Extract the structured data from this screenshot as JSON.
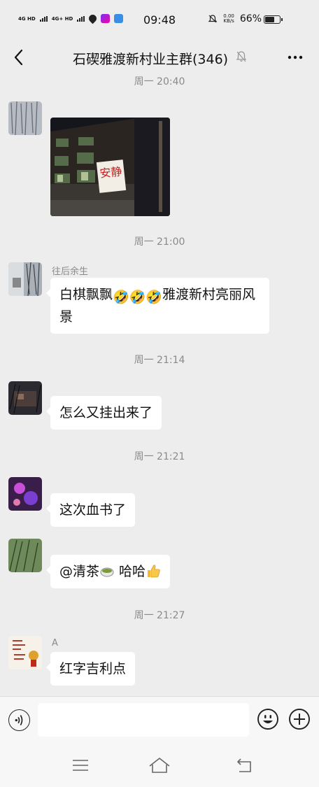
{
  "status_bar": {
    "net1": "4G HD",
    "net2": "4G+ HD",
    "time": "09:48",
    "speed_value": "0.00",
    "speed_unit": "KB/s",
    "battery": "66%",
    "battery_level": 0.66
  },
  "header": {
    "title": "石碶雅渡新村业主群(346)",
    "icons": [
      "back-arrow-icon",
      "mute-bell-icon",
      "more-icon"
    ]
  },
  "messages": [
    {
      "type": "time",
      "text": "周一 20:40"
    },
    {
      "type": "image",
      "sender": "",
      "image_caption": "安静"
    },
    {
      "type": "time",
      "text": "周一 21:00"
    },
    {
      "type": "text",
      "sender": "往后余生",
      "before_emoji": "白棋飘飘",
      "emojis": [
        "🤣",
        "🤣",
        "🤣"
      ],
      "after_emoji": "雅渡新村亮丽风景"
    },
    {
      "type": "time",
      "text": "周一 21:14"
    },
    {
      "type": "text",
      "sender": "",
      "text": "怎么又挂出来了"
    },
    {
      "type": "time",
      "text": "周一 21:21"
    },
    {
      "type": "text",
      "sender": "",
      "text": "这次血书了"
    },
    {
      "type": "text",
      "sender": "",
      "mention": "@清茶",
      "after_mention": " 哈哈"
    },
    {
      "type": "time",
      "text": "周一 21:27"
    },
    {
      "type": "text",
      "sender": "A",
      "text": "红字吉利点"
    }
  ],
  "input_bar": {
    "placeholder": "",
    "icons": [
      "voice-icon",
      "emoji-icon",
      "plus-icon"
    ]
  },
  "nav_bar": {
    "icons": [
      "menu-icon",
      "home-icon",
      "back-icon"
    ]
  },
  "colors": {
    "background": "#ededed",
    "bubble": "#ffffff",
    "timestamp": "#8a8a8a",
    "text": "#111111"
  }
}
